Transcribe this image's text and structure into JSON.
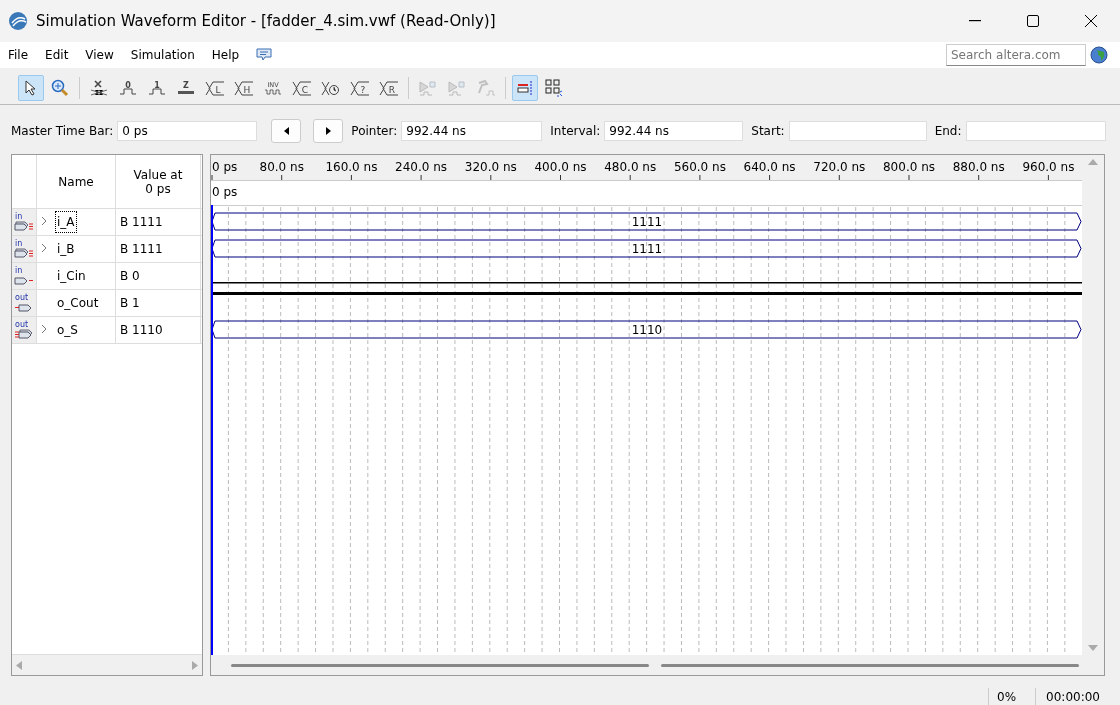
{
  "window": {
    "title": "Simulation Waveform Editor - [fadder_4.sim.vwf (Read-Only)]"
  },
  "menu": [
    "File",
    "Edit",
    "View",
    "Simulation",
    "Help"
  ],
  "search": {
    "placeholder": "Search altera.com"
  },
  "toolbar": [
    {
      "kind": "pointer",
      "selected": true,
      "disabled": false
    },
    {
      "kind": "zoom",
      "selected": false,
      "disabled": false
    },
    {
      "kind": "sep"
    },
    {
      "kind": "unknown",
      "selected": false,
      "disabled": false
    },
    {
      "kind": "low",
      "label": "0",
      "selected": false,
      "disabled": false
    },
    {
      "kind": "high",
      "label": "1",
      "selected": false,
      "disabled": false
    },
    {
      "kind": "z",
      "label": "Z",
      "selected": false,
      "disabled": false
    },
    {
      "kind": "bus",
      "label": "L",
      "selected": false,
      "disabled": false
    },
    {
      "kind": "bus",
      "label": "H",
      "selected": false,
      "disabled": false
    },
    {
      "kind": "inv",
      "label": "INV",
      "selected": false,
      "disabled": false
    },
    {
      "kind": "bus",
      "label": "C",
      "selected": false,
      "disabled": false
    },
    {
      "kind": "timer",
      "selected": false,
      "disabled": false
    },
    {
      "kind": "bus",
      "label": "?",
      "selected": false,
      "disabled": false
    },
    {
      "kind": "bus",
      "label": "R",
      "selected": false,
      "disabled": false
    },
    {
      "kind": "sep"
    },
    {
      "kind": "sim",
      "selected": false,
      "disabled": true
    },
    {
      "kind": "sim",
      "selected": false,
      "disabled": true
    },
    {
      "kind": "hammer",
      "selected": false,
      "disabled": true
    },
    {
      "kind": "sep"
    },
    {
      "kind": "snap",
      "selected": true,
      "disabled": false
    },
    {
      "kind": "grid",
      "selected": false,
      "disabled": false
    }
  ],
  "time_bar": {
    "master_label": "Master Time Bar:",
    "master_value": "0 ps",
    "pointer_label": "Pointer:",
    "pointer_value": "992.44 ns",
    "interval_label": "Interval:",
    "interval_value": "992.44 ns",
    "start_label": "Start:",
    "end_label": "End:"
  },
  "table": {
    "name_header": "Name",
    "value_header": "Value at",
    "value_header_time": "0 ps"
  },
  "ruler": [
    "0 ps",
    "80.0 ns",
    "160.0 ns",
    "240.0 ns",
    "320.0 ns",
    "400.0 ns",
    "480.0 ns",
    "560.0 ns",
    "640.0 ns",
    "720.0 ns",
    "800.0 ns",
    "880.0 ns",
    "960.0 ns"
  ],
  "cursor_label": "0 ps",
  "signals": [
    {
      "name": "i_A",
      "value_at": "B 1111",
      "io_label": "in",
      "kind": "bus",
      "focused": true,
      "wave_value": "1111"
    },
    {
      "name": "i_B",
      "value_at": "B 1111",
      "io_label": "in",
      "kind": "bus",
      "focused": false,
      "wave_value": "1111"
    },
    {
      "name": "i_Cin",
      "value_at": "B 0",
      "io_label": "in",
      "kind": "bit",
      "focused": false,
      "high": false
    },
    {
      "name": "o_Cout",
      "value_at": "B 1",
      "io_label": "out",
      "kind": "bit",
      "focused": false,
      "high": true
    },
    {
      "name": "o_S",
      "value_at": "B 1110",
      "io_label": "out",
      "kind": "bus",
      "focused": false,
      "wave_value": "1110"
    }
  ],
  "status_bar": {
    "progress": "0%",
    "elapsed": "00:00:00"
  }
}
